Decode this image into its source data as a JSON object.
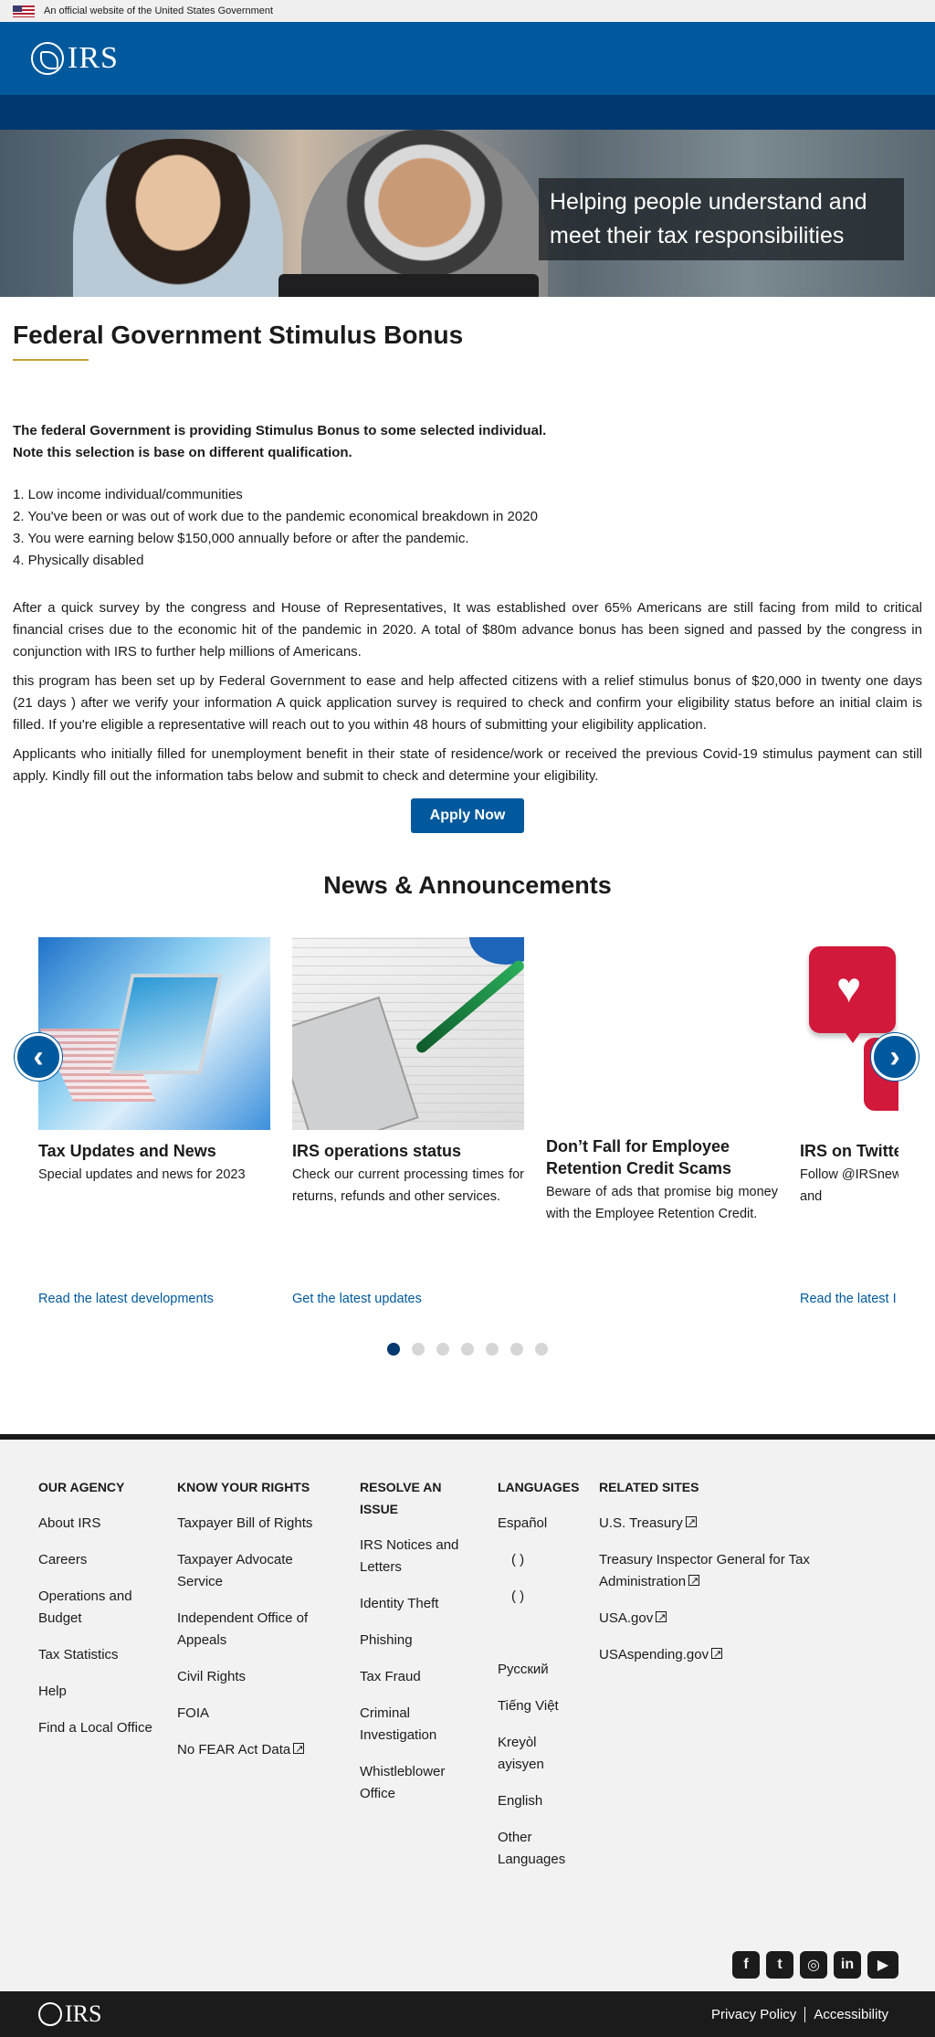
{
  "gov_banner": {
    "text": "An official website of the United States Government"
  },
  "header": {
    "logo_text": "IRS"
  },
  "hero": {
    "tagline": "Helping people understand and meet their tax responsibilities"
  },
  "main": {
    "title": "Federal Government Stimulus Bonus",
    "intro_line1": "The federal Government is providing Stimulus Bonus to some selected individual.",
    "intro_line2": "Note this selection is base on different qualification.",
    "requirements": [
      "1. Low income individual/communities",
      "2. You've been or was out of work due to the pandemic economical breakdown in 2020",
      "3. You were earning below $150,000 annually before or after the pandemic.",
      "4. Physically disabled"
    ],
    "paragraphs": [
      "After a quick survey by the congress and House of Representatives, It was established over 65% Americans are still facing from mild to critical financial crises due to the economic hit of the pandemic in 2020. A total of $80m advance bonus has been signed and passed by the congress in conjunction with IRS to further help millions of Americans.",
      "this program has been set up by Federal Government to ease and help affected citizens with a relief stimulus bonus of $20,000 in twenty one days (21 days ) after we verify your information A quick application survey is required to check and confirm your eligibility status before an initial claim is filled. If you're eligible a representative will reach out to you within 48 hours of submitting your eligibility application.",
      "Applicants who initially filled for unemployment benefit in their state of residence/work or received the previous Covid-19 stimulus payment can still apply. Kindly fill out the information tabs below and submit to check and determine your eligibility."
    ],
    "apply_label": "Apply Now"
  },
  "news": {
    "title": "News & Announcements",
    "cards": [
      {
        "title": "Tax Updates and News",
        "text": "Special updates and news for 2023",
        "link": "Read the latest developments"
      },
      {
        "title": "IRS operations status",
        "text": "Check our current processing times for returns, refunds and other services.",
        "link": "Get the latest updates"
      },
      {
        "title": "Don’t Fall for Employee Retention Credit Scams",
        "text": "Beware of ads that promise big money with the Employee Retention Credit.",
        "link": ""
      },
      {
        "title": "IRS on Twitter",
        "text": "Follow @IRSnews for the latest news and",
        "link": "Read the latest I"
      }
    ],
    "prev_icon": "chevron-left",
    "next_icon": "chevron-right",
    "dots_total": 7,
    "dots_active": 1
  },
  "footer": {
    "columns": [
      {
        "heading": "OUR AGENCY",
        "items": [
          "About IRS",
          "Careers",
          "Operations and Budget",
          "Tax Statistics",
          "Help",
          "Find a Local Office"
        ]
      },
      {
        "heading": "KNOW YOUR RIGHTS",
        "items": [
          "Taxpayer Bill of Rights",
          "Taxpayer Advocate Service",
          "Independent Office of Appeals",
          "Civil Rights",
          "FOIA",
          "No FEAR Act Data"
        ]
      },
      {
        "heading": "RESOLVE AN ISSUE",
        "items": [
          "IRS Notices and Letters",
          "Identity Theft",
          "Phishing",
          "Tax Fraud",
          "Criminal Investigation",
          "Whistleblower Office"
        ]
      },
      {
        "heading": "LANGUAGES",
        "items": [
          "Español",
          "(   )",
          "(   )",
          "",
          "Русский",
          "Tiếng Việt",
          "Kreyòl ayisyen",
          "English",
          "Other Languages"
        ]
      },
      {
        "heading": "RELATED SITES",
        "items": [
          "U.S. Treasury",
          "Treasury Inspector General for Tax Administration",
          "USA.gov",
          "USAspending.gov"
        ]
      }
    ],
    "social": [
      "facebook-icon",
      "twitter-icon",
      "instagram-icon",
      "linkedin-icon",
      "youtube-icon"
    ],
    "bottom_logo": "IRS",
    "privacy": "Privacy Policy",
    "accessibility": "Accessibility"
  }
}
